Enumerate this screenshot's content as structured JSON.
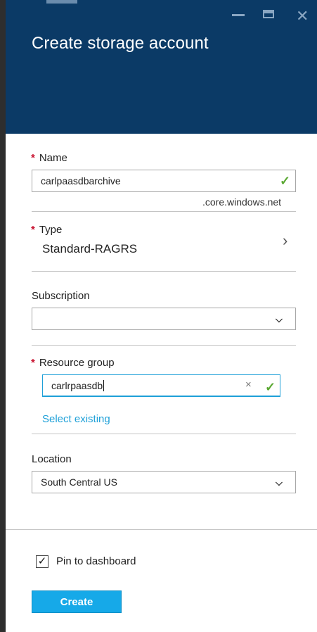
{
  "blade": {
    "title": "Create storage account",
    "controls": {
      "minimize_icon": "minimize-icon",
      "maximize_icon": "maximize-icon",
      "close_glyph": "✕"
    }
  },
  "form": {
    "name": {
      "required_mark": "*",
      "label": "Name",
      "value": "carlpaasdbarchive",
      "suffix": ".core.windows.net",
      "valid": true
    },
    "type": {
      "required_mark": "*",
      "label": "Type",
      "value": "Standard-RAGRS"
    },
    "subscription": {
      "label": "Subscription",
      "value": ""
    },
    "resource_group": {
      "required_mark": "*",
      "label": "Resource group",
      "value": "carlrpaasdb",
      "clear_glyph": "×",
      "link": "Select existing",
      "valid": true
    },
    "location": {
      "label": "Location",
      "value": "South Central US"
    }
  },
  "footer": {
    "pin_label": "Pin to dashboard",
    "pin_checked": true,
    "create_label": "Create"
  },
  "colors": {
    "header_bg": "#0b3a66",
    "accent": "#16a9e8",
    "valid": "#5aa832",
    "required": "#c8102e"
  }
}
